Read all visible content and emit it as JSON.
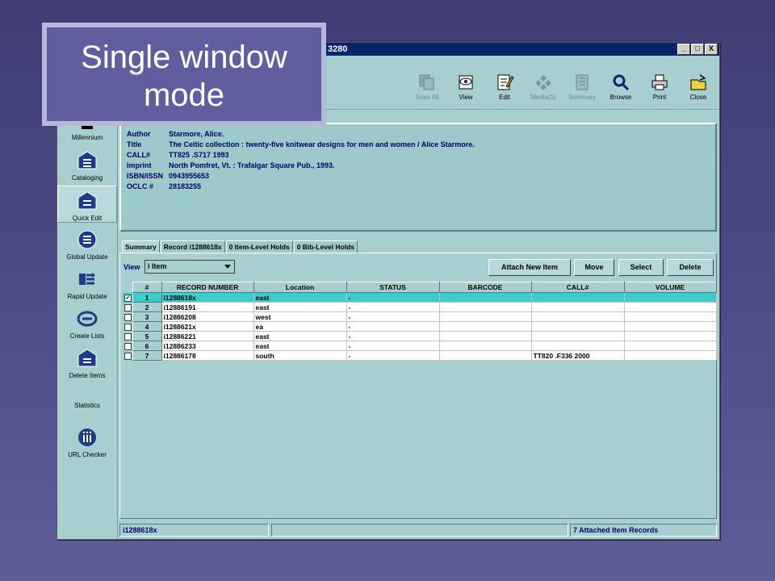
{
  "window": {
    "title_fragment": "3280",
    "controls": [
      "_",
      "□",
      "X"
    ]
  },
  "toolbar": {
    "items": [
      {
        "label": "Save All",
        "icon": "save-all-icon",
        "enabled": false
      },
      {
        "label": "View",
        "icon": "view-icon",
        "enabled": true
      },
      {
        "label": "Edit",
        "icon": "edit-icon",
        "enabled": true
      },
      {
        "label": "Media(1)",
        "icon": "media-icon",
        "enabled": false
      },
      {
        "label": "Summary",
        "icon": "summary-icon",
        "enabled": false
      },
      {
        "label": "Browse",
        "icon": "browse-icon",
        "enabled": true
      },
      {
        "label": "Print",
        "icon": "print-icon",
        "enabled": true
      },
      {
        "label": "Close",
        "icon": "close-icon",
        "enabled": true
      }
    ]
  },
  "sidebar": {
    "items": [
      {
        "label": "Millennium",
        "icon": "millennium-icon"
      },
      {
        "label": "Cataloging",
        "icon": "cataloging-icon"
      },
      {
        "label": "Quick Edit",
        "icon": "quick-edit-icon",
        "active": true
      },
      {
        "label": "Global Update",
        "icon": "global-update-icon"
      },
      {
        "label": "Rapid Update",
        "icon": "rapid-update-icon"
      },
      {
        "label": "Create Lists",
        "icon": "create-lists-icon"
      },
      {
        "label": "Delete Items",
        "icon": "delete-items-icon"
      },
      {
        "label": "Statistics",
        "icon": ""
      },
      {
        "label": "URL Checker",
        "icon": "url-checker-icon"
      }
    ]
  },
  "bib": {
    "rows": [
      {
        "label": "Author",
        "value": "Starmore, Alice."
      },
      {
        "label": "Title",
        "value": "The Celtic collection : twenty-five knitwear designs for men and women / Alice Starmore."
      },
      {
        "label": "CALL#",
        "value": "TT825 .S717 1993"
      },
      {
        "label": "Imprint",
        "value": "North Pomfret, Vt. : Trafalgar Square Pub., 1993."
      },
      {
        "label": "ISBN/ISSN",
        "value": "0943955653"
      },
      {
        "label": "OCLC #",
        "value": "28183255"
      }
    ]
  },
  "tabs": [
    {
      "label": "Summary",
      "active": true
    },
    {
      "label": "Record i1288618x"
    },
    {
      "label": "0 Item-Level Holds"
    },
    {
      "label": "0 Bib-Level Holds"
    }
  ],
  "summary": {
    "view_label": "View",
    "view_value": "i Item",
    "buttons": {
      "attach": "Attach New Item",
      "move": "Move",
      "select": "Select",
      "delete": "Delete"
    },
    "columns": [
      "#",
      "RECORD NUMBER",
      "Location",
      "STATUS",
      "BARCODE",
      "CALL#",
      "VOLUME"
    ],
    "rows": [
      {
        "num": "1",
        "record": "i1288618x",
        "location": "east",
        "status": "-",
        "barcode": "",
        "call": "",
        "volume": "",
        "checked": true,
        "selected": true
      },
      {
        "num": "2",
        "record": "i12886191",
        "location": "east",
        "status": "-",
        "barcode": "",
        "call": "",
        "volume": ""
      },
      {
        "num": "3",
        "record": "i12886208",
        "location": "west",
        "status": "-",
        "barcode": "",
        "call": "",
        "volume": ""
      },
      {
        "num": "4",
        "record": "i1288621x",
        "location": "ea",
        "status": "-",
        "barcode": "",
        "call": "",
        "volume": ""
      },
      {
        "num": "5",
        "record": "i12886221",
        "location": "east",
        "status": "-",
        "barcode": "",
        "call": "",
        "volume": ""
      },
      {
        "num": "6",
        "record": "i12886233",
        "location": "east",
        "status": "-",
        "barcode": "",
        "call": "",
        "volume": ""
      },
      {
        "num": "7",
        "record": "i12886178",
        "location": "south",
        "status": "-",
        "barcode": "",
        "call": "TT820 .F336 2000",
        "volume": ""
      }
    ]
  },
  "status": {
    "record": "i1288618x",
    "middle": "",
    "count": "7 Attached Item Records"
  },
  "callout": {
    "line1": "Single window",
    "line2": "mode"
  }
}
